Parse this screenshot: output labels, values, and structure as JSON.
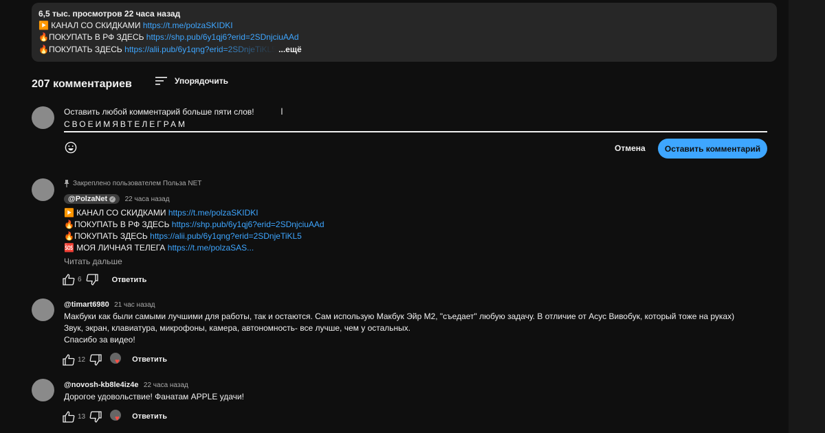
{
  "description": {
    "meta": "6,5 тыс. просмотров  22 часа назад",
    "lines": [
      {
        "prefix": "▶️ КАНАЛ СО СКИДКАМИ ",
        "link": "https://t.me/polzaSKIDKI"
      },
      {
        "prefix": "🔥ПОКУПАТЬ В РФ ЗДЕСЬ ",
        "link": "https://shp.pub/6y1qj6?erid=2SDnjciuAAd"
      },
      {
        "prefix": "🔥ПОКУПАТЬ ЗДЕСЬ ",
        "link": "https://alii.pub/6y1qng?erid=2SDnjeTiKL5",
        "more": " ...ещё"
      }
    ]
  },
  "comments_header": {
    "count": "207 комментариев",
    "sort_label": "Упорядочить"
  },
  "composer": {
    "line1": "Оставить любой комментарий больше пяти слов!",
    "line2": "СВОЕИМЯВТЕЛЕГРАМ",
    "cancel_label": "Отмена",
    "submit_label": "Оставить комментарий"
  },
  "comments": [
    {
      "pinned": "Закреплено пользователем Польза NET",
      "author": "@PolzaNet",
      "time": "22 часа назад",
      "lines": [
        {
          "prefix": "▶️ КАНАЛ СО СКИДКАМИ ",
          "link": "https://t.me/polzaSKIDKI"
        },
        {
          "prefix": "🔥ПОКУПАТЬ В РФ ЗДЕСЬ ",
          "link": "https://shp.pub/6y1qj6?erid=2SDnjciuAAd"
        },
        {
          "prefix": "🔥ПОКУПАТЬ ЗДЕСЬ ",
          "link": "https://alii.pub/6y1qng?erid=2SDnjeTiKL5"
        },
        {
          "prefix": "🆘 МОЯ ЛИЧНАЯ ТЕЛЕГА ",
          "link": "https://t.me/polzaSAS..."
        }
      ],
      "read_more": "Читать дальше",
      "likes": "6",
      "reply_label": "Ответить"
    },
    {
      "author": "@timart6980",
      "time": "21 час назад",
      "lines": [
        "Макбуки как были самыми лучшими для работы, так и остаются. Сам использую  Макбук Эйр М2, \"съедает\" любую задачу. В отличие от Асус Вивобук, который тоже на руках)",
        "Звук, экран, клавиатура, микрофоны, камера, автономность- все лучше, чем у остальных.",
        "Спасибо за видео!"
      ],
      "likes": "12",
      "reply_label": "Ответить"
    },
    {
      "author": "@novosh-kb8le4iz4e",
      "time": "22 часа назад",
      "lines": [
        "Дорогое удовольствие! Фанатам APPLE удачи!"
      ],
      "likes": "13",
      "reply_label": "Ответить"
    }
  ],
  "icons": {
    "sort": "sort-icon",
    "emoji": "emoji-icon",
    "like": "thumb-up-icon",
    "dislike": "thumb-down-icon",
    "pin": "pin-icon",
    "heart": "heart-icon"
  },
  "colors": {
    "background": "#0f0f0f",
    "panel": "#272727",
    "link": "#3ea6ff",
    "submit_button": "#3ea6ff",
    "heart": "#ff4e45"
  }
}
